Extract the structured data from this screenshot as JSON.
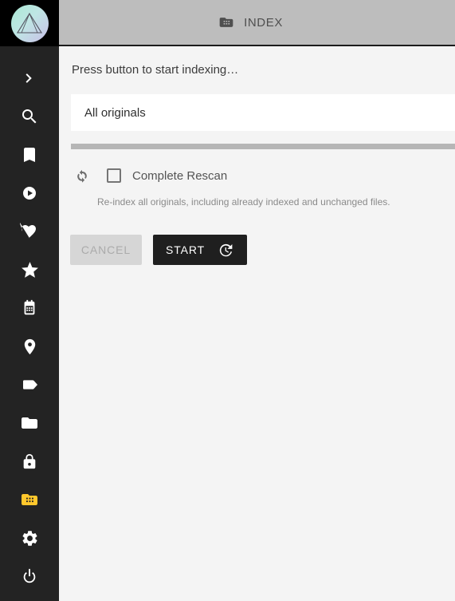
{
  "app": {
    "logo_name": "photoprism-logo",
    "accent_amber": "#ffc72c",
    "sidebar_bg": "#232323",
    "header_bg": "#bdbdbd",
    "content_bg": "#f4f4f4"
  },
  "header": {
    "icon": "index-folder-icon",
    "title": "INDEX"
  },
  "sidebar": {
    "items": [
      {
        "icon": "chevron-right-icon",
        "name": "sidebar-item-expand",
        "active": false
      },
      {
        "icon": "search-icon",
        "name": "sidebar-item-search",
        "active": false
      },
      {
        "icon": "bookmark-icon",
        "name": "sidebar-item-albums",
        "active": false
      },
      {
        "icon": "play-circle-icon",
        "name": "sidebar-item-videos",
        "active": false
      },
      {
        "icon": "heart-icon",
        "name": "sidebar-item-favorites",
        "active": false
      },
      {
        "icon": "star-icon",
        "name": "sidebar-item-moments",
        "active": false
      },
      {
        "icon": "calendar-icon",
        "name": "sidebar-item-calendar",
        "active": false
      },
      {
        "icon": "location-pin-icon",
        "name": "sidebar-item-places",
        "active": false
      },
      {
        "icon": "label-tag-icon",
        "name": "sidebar-item-labels",
        "active": false
      },
      {
        "icon": "folder-icon",
        "name": "sidebar-item-folders",
        "active": false
      },
      {
        "icon": "lock-icon",
        "name": "sidebar-item-private",
        "active": false
      },
      {
        "icon": "index-folder-icon",
        "name": "sidebar-item-index",
        "active": true
      },
      {
        "icon": "gear-icon",
        "name": "sidebar-item-settings",
        "active": false
      },
      {
        "icon": "power-icon",
        "name": "sidebar-item-logout",
        "active": false
      }
    ]
  },
  "main": {
    "status_text": "Press button to start indexing…",
    "path_select": {
      "value": "All originals",
      "placeholder": "All originals"
    },
    "progress": {
      "percent": 0,
      "indeterminate": false
    },
    "rescan": {
      "icon": "sync-refresh-icon",
      "label": "Complete Rescan",
      "checked": false,
      "hint": "Re-index all originals, including already indexed and unchanged files."
    },
    "buttons": {
      "cancel_label": "CANCEL",
      "cancel_disabled": true,
      "start_label": "START",
      "start_icon": "update-rotate-icon"
    }
  }
}
